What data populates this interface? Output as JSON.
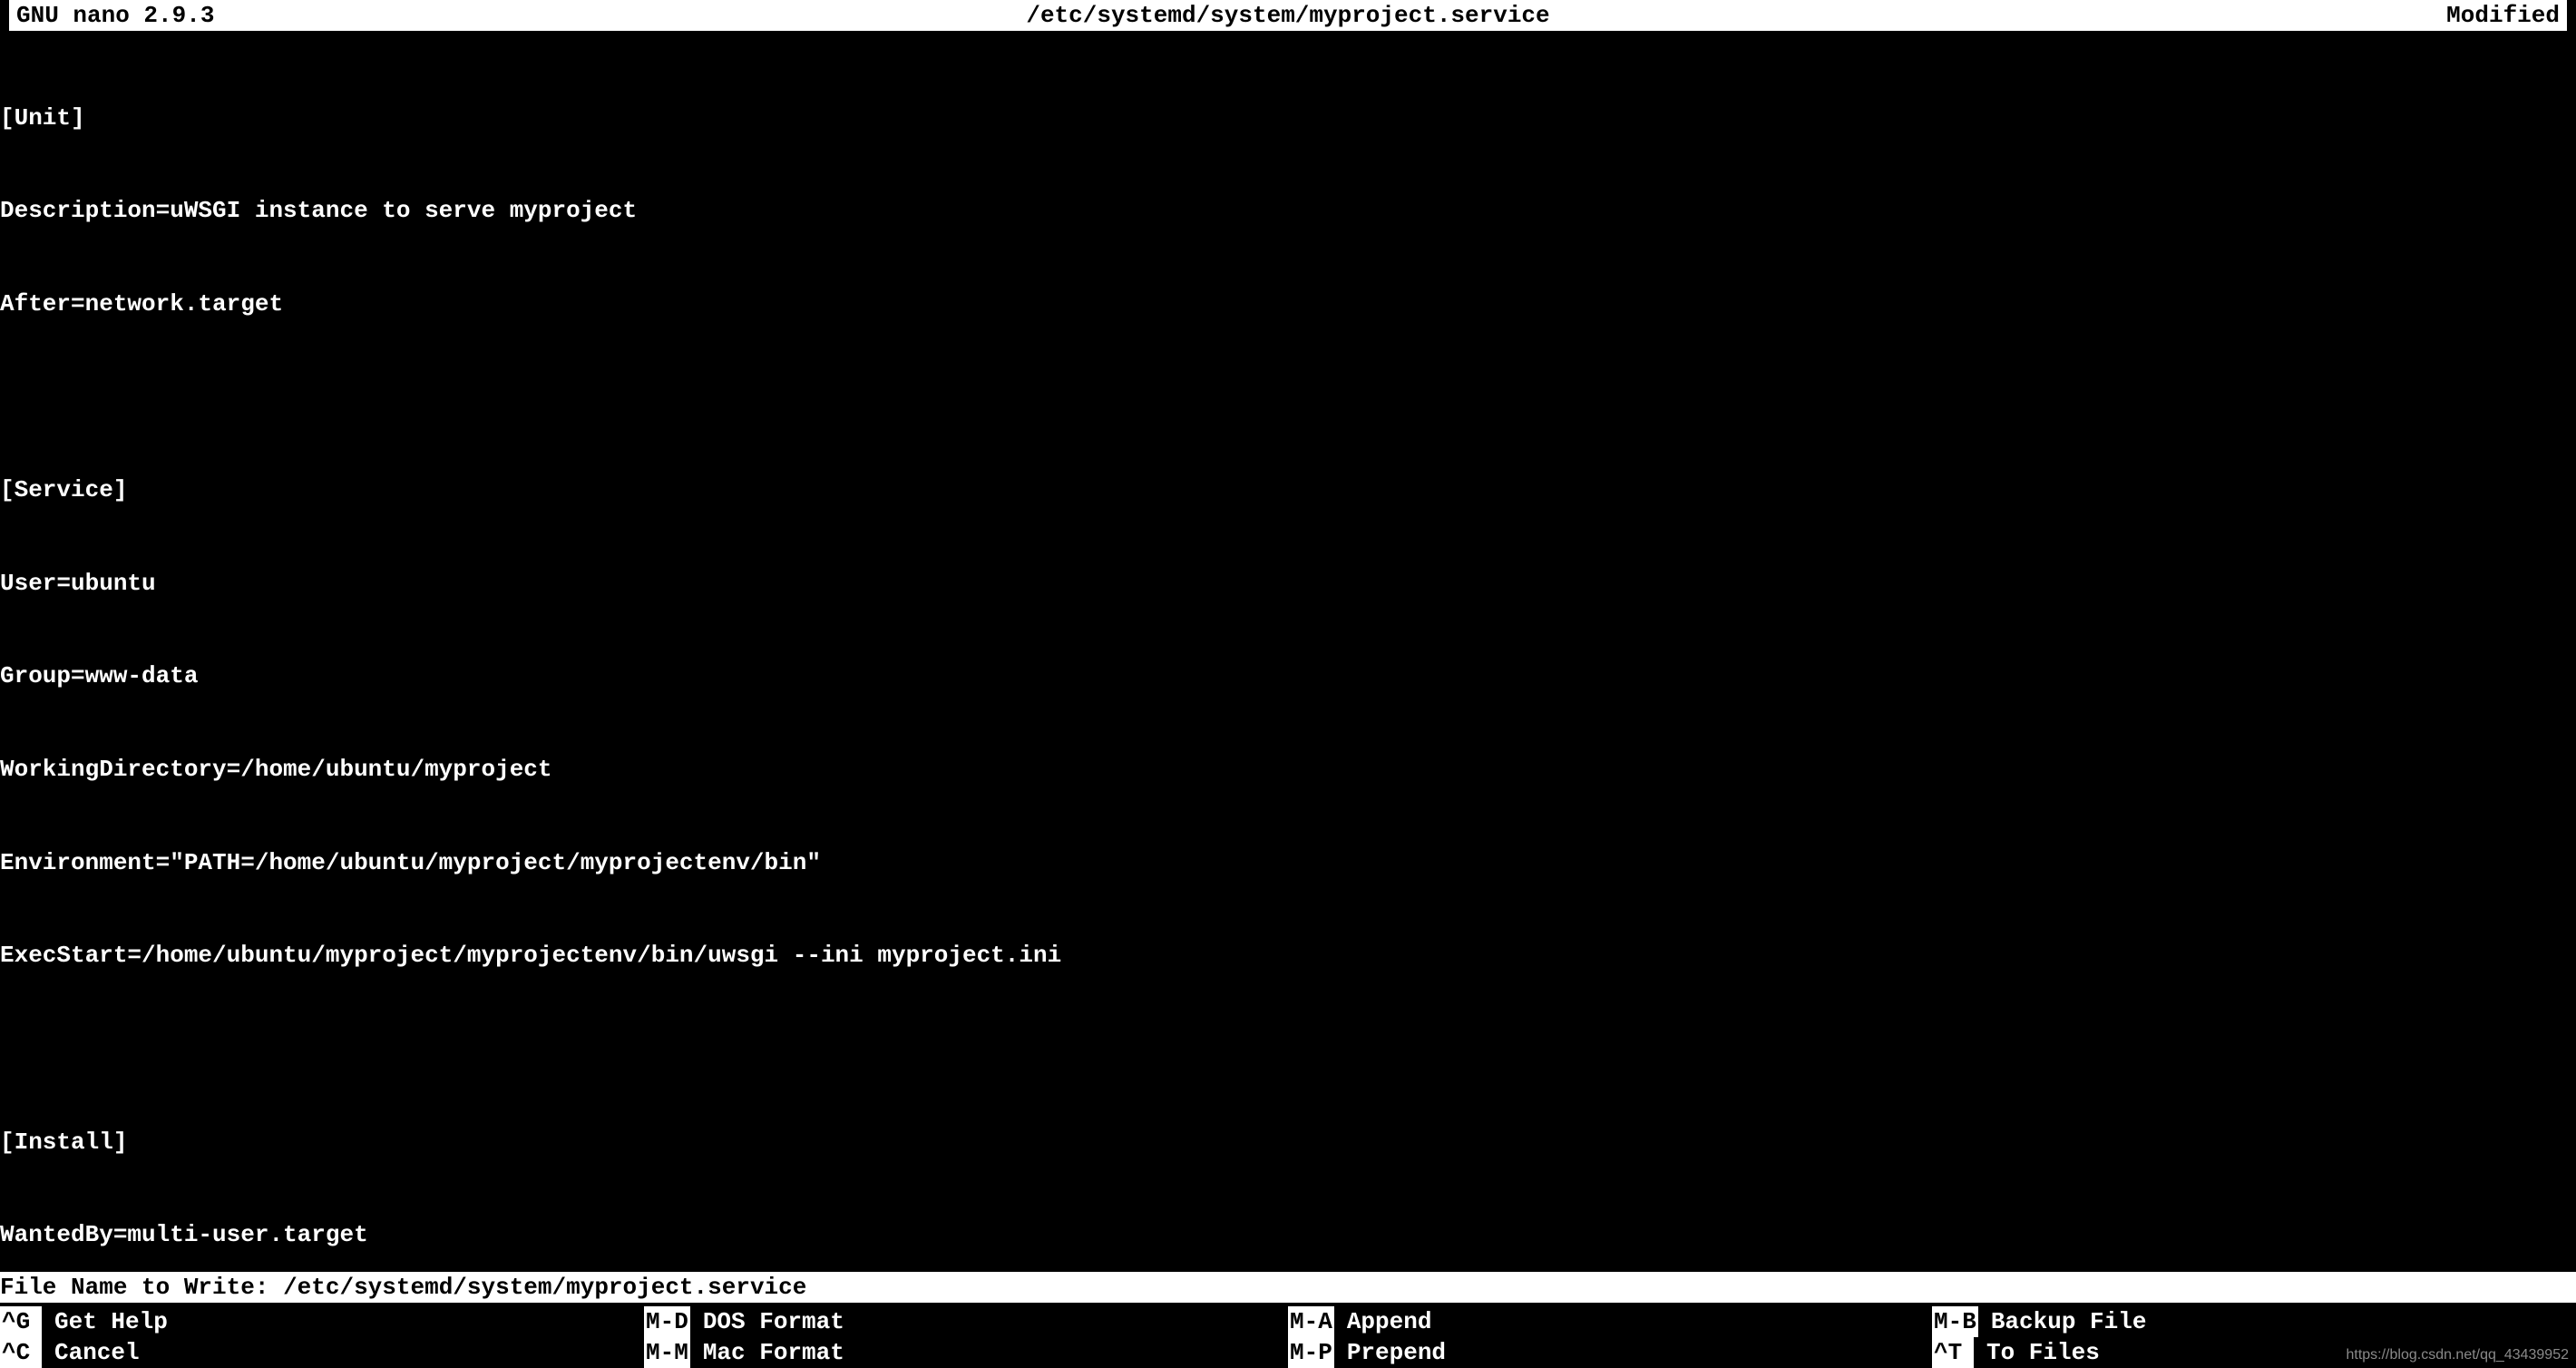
{
  "title": {
    "app": "GNU nano 2.9.3",
    "file": "/etc/systemd/system/myproject.service",
    "status": "Modified"
  },
  "content": [
    "[Unit]",
    "Description=uWSGI instance to serve myproject",
    "After=network.target",
    "",
    "[Service]",
    "User=ubuntu",
    "Group=www-data",
    "WorkingDirectory=/home/ubuntu/myproject",
    "Environment=\"PATH=/home/ubuntu/myproject/myprojectenv/bin\"",
    "ExecStart=/home/ubuntu/myproject/myprojectenv/bin/uwsgi --ini myproject.ini",
    "",
    "[Install]",
    "WantedBy=multi-user.target"
  ],
  "prompt": {
    "label": "File Name to Write: ",
    "value": "/etc/systemd/system/myproject.service"
  },
  "help": {
    "row1": [
      {
        "key": "^G",
        "desc": "Get Help"
      },
      {
        "key": "M-D",
        "desc": "DOS Format"
      },
      {
        "key": "M-A",
        "desc": "Append"
      },
      {
        "key": "M-B",
        "desc": "Backup File"
      }
    ],
    "row2": [
      {
        "key": "^C",
        "desc": "Cancel"
      },
      {
        "key": "M-M",
        "desc": "Mac Format"
      },
      {
        "key": "M-P",
        "desc": "Prepend"
      },
      {
        "key": "^T",
        "desc": "To Files"
      }
    ]
  },
  "watermark": "https://blog.csdn.net/qq_43439952"
}
